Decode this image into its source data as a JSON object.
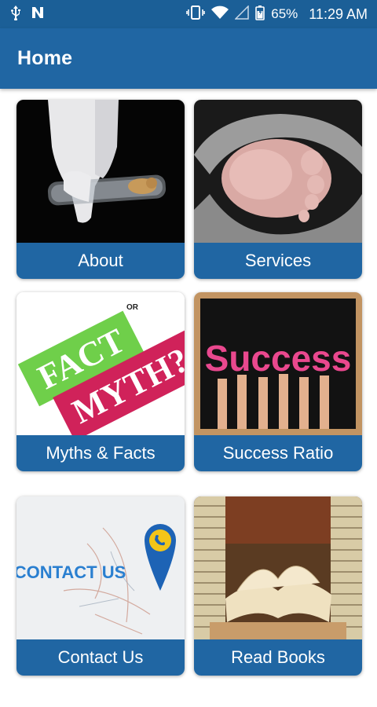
{
  "status_bar": {
    "battery": "65%",
    "time": "11:29 AM",
    "icons": [
      "usb-icon",
      "n-notification-icon",
      "vibrate-icon",
      "wifi-icon",
      "signal-icon",
      "battery-icon"
    ]
  },
  "app_bar": {
    "title": "Home"
  },
  "tiles": [
    {
      "label": "About",
      "image": "lab-test-tube-image"
    },
    {
      "label": "Services",
      "image": "baby-feet-hands-image"
    },
    {
      "label": "Myths & Facts",
      "image": "fact-myth-image",
      "image_text": [
        "FACT",
        "MYTH?",
        "OR"
      ]
    },
    {
      "label": "Success Ratio",
      "image": "success-blackboard-image",
      "image_text": "Success"
    },
    {
      "label": "Contact Us",
      "image": "contact-map-pin-image",
      "image_text": "CONTACT US"
    },
    {
      "label": "Read Books",
      "image": "open-books-image"
    }
  ],
  "colors": {
    "status_bar": "#1b5f97",
    "app_bar": "#2066a3",
    "tile_label_bg": "#2066a3"
  }
}
